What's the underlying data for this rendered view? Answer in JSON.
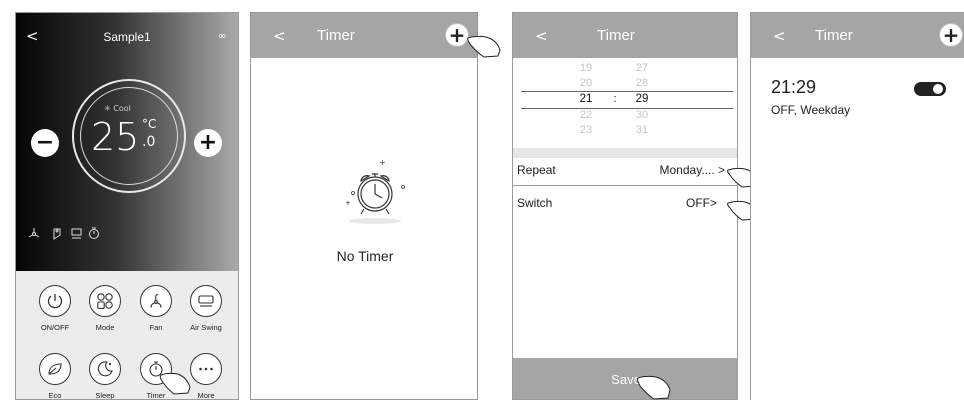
{
  "screen1": {
    "title": "Sample1",
    "back": "<",
    "more": "∞",
    "mode_label": "✳ Cool",
    "temp_main": "25",
    "temp_unit": "°C",
    "temp_decimal": ".0",
    "minus": "−",
    "plus": "+",
    "buttons": [
      {
        "label": "ON/OFF",
        "icon": "power-icon"
      },
      {
        "label": "Mode",
        "icon": "mode-icon"
      },
      {
        "label": "Fan",
        "icon": "fan-icon"
      },
      {
        "label": "Air Swing",
        "icon": "swing-icon"
      },
      {
        "label": "Eco",
        "icon": "leaf-icon"
      },
      {
        "label": "Sleep",
        "icon": "moon-icon"
      },
      {
        "label": "Timer",
        "icon": "timer-icon"
      },
      {
        "label": "More",
        "icon": "ellipsis-icon"
      }
    ]
  },
  "screen2": {
    "back": "<",
    "title": "Timer",
    "plus": "+",
    "empty_text": "No Timer"
  },
  "screen3": {
    "back": "<",
    "title": "Timer",
    "hours": [
      "19",
      "20",
      "21",
      "22",
      "23"
    ],
    "minutes": [
      "27",
      "28",
      "29",
      "30",
      "31"
    ],
    "separator": ":",
    "repeat_label": "Repeat",
    "repeat_value": "Monday.... >",
    "switch_label": "Switch",
    "switch_value": "OFF>",
    "save_label": "Save"
  },
  "screen4": {
    "back": "<",
    "title": "Timer",
    "plus": "+",
    "timer_time": "21:29",
    "timer_desc": "OFF, Weekday"
  },
  "colors": {
    "header_gray": "#a5a5a5",
    "bottom_panel": "#ececec"
  }
}
